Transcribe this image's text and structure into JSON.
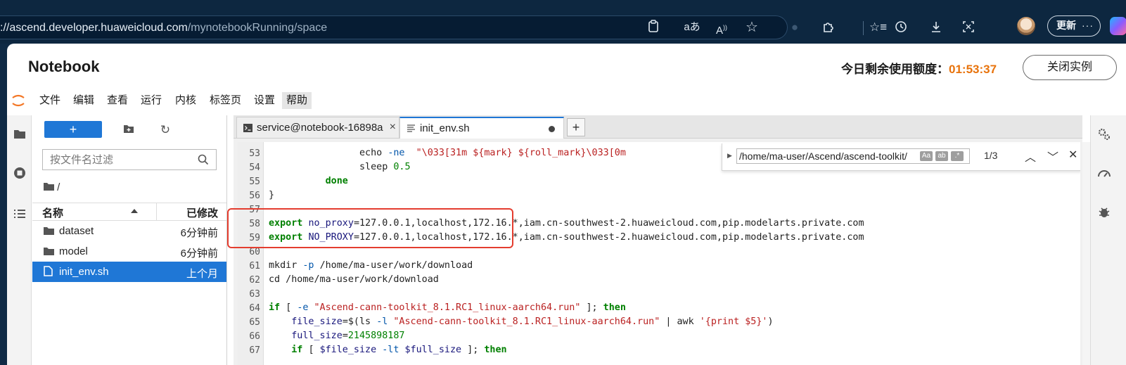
{
  "browser": {
    "url_host": "://ascend.developer.huaweicloud.com",
    "url_path": "/mynotebookRunning/space",
    "update_label": "更新",
    "more_label": "···",
    "icons": [
      "reading-list-icon",
      "translate-icon",
      "read-aloud-icon",
      "favorite-star-icon",
      "extensions-icon",
      "favorites-icon",
      "history-icon",
      "downloads-icon",
      "screenshot-icon",
      "profile-avatar",
      "copilot-icon"
    ]
  },
  "header": {
    "title": "Notebook",
    "quota_label": "今日剩余使用额度：",
    "quota_time": "01:53:37",
    "close_instance": "关闭实例"
  },
  "menu": [
    "文件",
    "编辑",
    "查看",
    "运行",
    "内核",
    "标签页",
    "设置",
    "帮助"
  ],
  "files": {
    "new_label": "+",
    "filter_placeholder": "按文件名过滤",
    "breadcrumb": "/",
    "col_name": "名称",
    "col_modified": "已修改",
    "rows": [
      {
        "name": "dataset",
        "modified": "6分钟前",
        "type": "folder"
      },
      {
        "name": "model",
        "modified": "6分钟前",
        "type": "folder"
      },
      {
        "name": "init_env.sh",
        "modified": "上个月",
        "type": "file"
      }
    ]
  },
  "tabs": [
    {
      "label": "service@notebook-16898a",
      "close": "×"
    },
    {
      "label": "init_env.sh"
    }
  ],
  "search": {
    "query": "/home/ma-user/Ascend/ascend-toolkit/",
    "opt_case": "Aa",
    "opt_word": "ab",
    "opt_regex": ".*",
    "count": "1/3"
  },
  "code": {
    "lines": [
      "53",
      "54",
      "55",
      "56",
      "57",
      "58",
      "59",
      "60",
      "61",
      "62",
      "63",
      "64",
      "65",
      "66",
      "67"
    ],
    "l53_a": "echo",
    "l53_b": "-ne",
    "l53_c": "\"\\033[31m ${mark} ${roll_mark}\\033[0m",
    "l54_a": "sleep",
    "l54_b": "0.5",
    "l55": "done",
    "l56": "}",
    "l58_kw": "export",
    "l58_var": "no_proxy",
    "l58_eq": "=",
    "l58_val": "127.0.0.1,localhost,172.16.*,iam.cn-southwest-2.huaweicloud.com,pip.modelarts.private.com",
    "l59_kw": "export",
    "l59_var": "NO_PROXY",
    "l59_eq": "=",
    "l59_val": "127.0.0.1,localhost,172.16.*,iam.cn-southwest-2.huaweicloud.com,pip.modelarts.private.com",
    "l61_a": "mkdir",
    "l61_b": "-p",
    "l61_c": "/home/ma-user/work/download",
    "l62": "cd /home/ma-user/work/download",
    "l64_kw": "if",
    "l64_b": "[",
    "l64_c": "-e",
    "l64_d": "\"Ascend-cann-toolkit_8.1.RC1_linux-aarch64.run\"",
    "l64_e": "];",
    "l64_f": "then",
    "l65_var": "file_size",
    "l65_eq": "=$(ls",
    "l65_b": "-l",
    "l65_c": "\"Ascend-cann-toolkit_8.1.RC1_linux-aarch64.run\"",
    "l65_d": "| awk",
    "l65_e": "'{print $5}'",
    "l65_f": ")",
    "l66_var": "full_size",
    "l66_eq": "=",
    "l66_val": "2145898187",
    "l67_kw": "if",
    "l67_b": "[",
    "l67_c": "$file_size",
    "l67_d": "-lt",
    "l67_e": "$full_size",
    "l67_f": "];",
    "l67_g": "then"
  }
}
